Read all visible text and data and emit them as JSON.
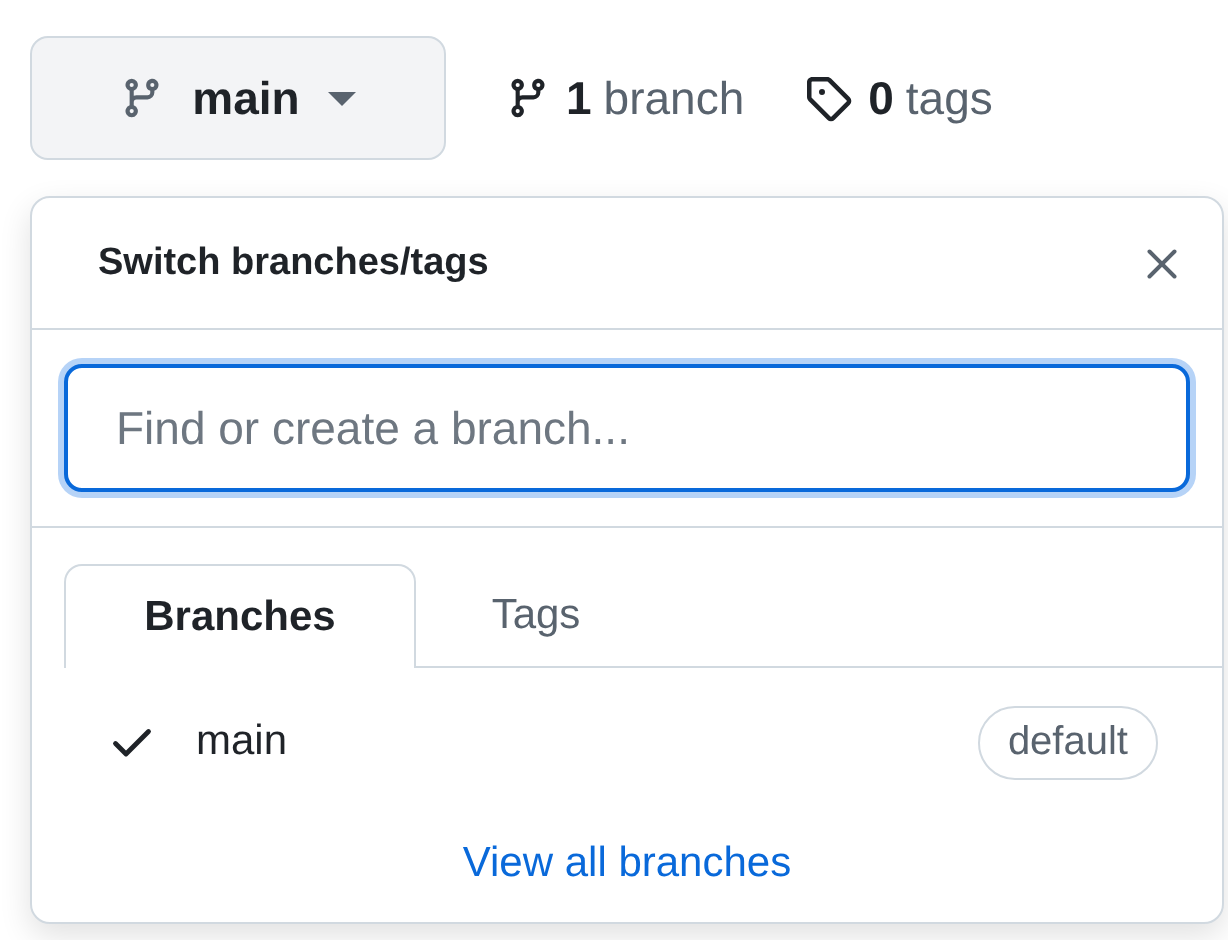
{
  "branch_button": {
    "label": "main"
  },
  "branch_count": {
    "count": "1",
    "label": "branch"
  },
  "tag_count": {
    "count": "0",
    "label": "tags"
  },
  "popup": {
    "title": "Switch branches/tags",
    "search": {
      "placeholder": "Find or create a branch..."
    },
    "tabs": [
      {
        "label": "Branches",
        "selected": true
      },
      {
        "label": "Tags",
        "selected": false
      }
    ],
    "items": [
      {
        "name": "main",
        "checked": true,
        "badge": "default"
      }
    ],
    "footer_link": "View all branches"
  }
}
